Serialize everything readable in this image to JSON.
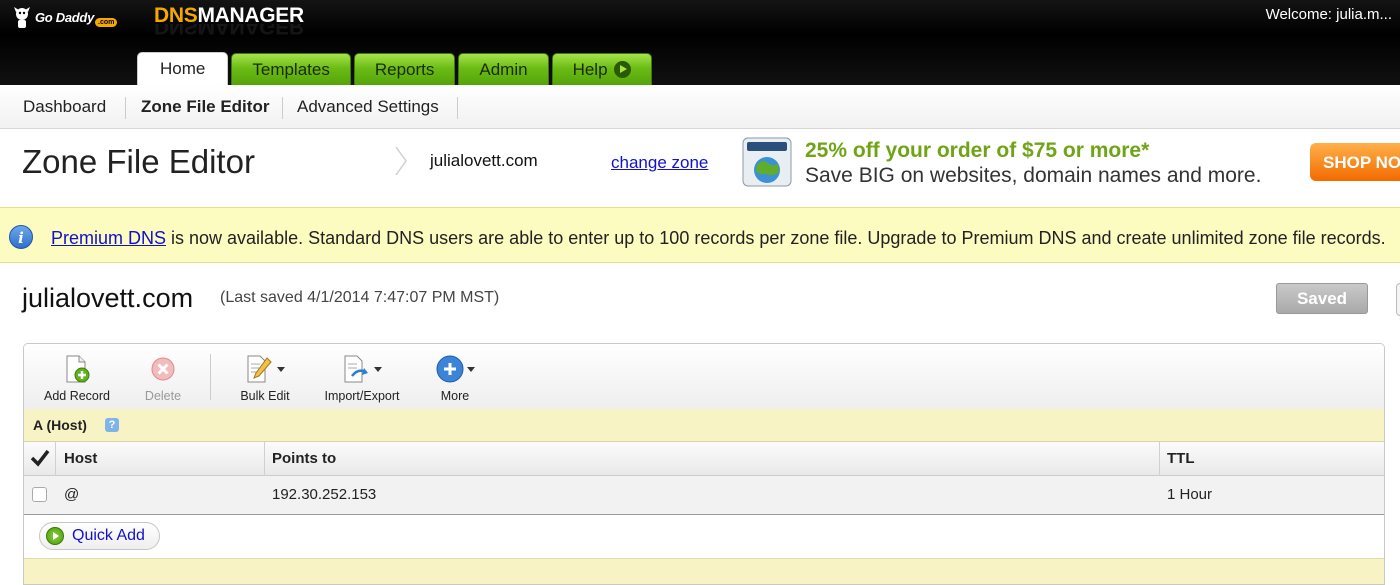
{
  "header": {
    "logo_text": "Go Daddy",
    "logo_suffix": ".com",
    "app_name_prefix": "DNS",
    "app_name_suffix": "MANAGER",
    "welcome": "Welcome: julia.m..."
  },
  "main_tabs": [
    {
      "label": "Home",
      "active": true
    },
    {
      "label": "Templates"
    },
    {
      "label": "Reports"
    },
    {
      "label": "Admin"
    },
    {
      "label": "Help"
    }
  ],
  "sub_nav": [
    {
      "label": "Dashboard"
    },
    {
      "label": "Zone File Editor",
      "active": true
    },
    {
      "label": "Advanced Settings"
    }
  ],
  "page": {
    "title": "Zone File Editor",
    "zone": "julialovett.com",
    "change_zone": "change zone"
  },
  "promo": {
    "headline": "25% off your order of $75 or more*",
    "subline": "Save BIG on websites, domain names and more.",
    "cta": "SHOP NOW"
  },
  "notice": {
    "link": "Premium DNS",
    "text": " is now available. Standard DNS users are able to enter up to 100 records per zone file. Upgrade to Premium DNS and create unlimited zone file records."
  },
  "domain": {
    "name": "julialovett.com",
    "last_saved": "(Last saved 4/1/2014 7:47:07 PM MST)",
    "saved_button": "Saved"
  },
  "toolbar": {
    "add_record": "Add Record",
    "delete": "Delete",
    "bulk_edit": "Bulk Edit",
    "import_export": "Import/Export",
    "more": "More"
  },
  "records": {
    "section_title": "A (Host)",
    "help": "?",
    "columns": [
      "Host",
      "Points to",
      "TTL"
    ],
    "rows": [
      {
        "host": "@",
        "points_to": "192.30.252.153",
        "ttl": "1 Hour"
      }
    ],
    "quick_add": "Quick Add"
  },
  "colors": {
    "accent_green": "#6cbc16",
    "brand_orange": "#f6a800",
    "notice_bg": "#fcfbc0",
    "link_blue": "#1111cc"
  }
}
